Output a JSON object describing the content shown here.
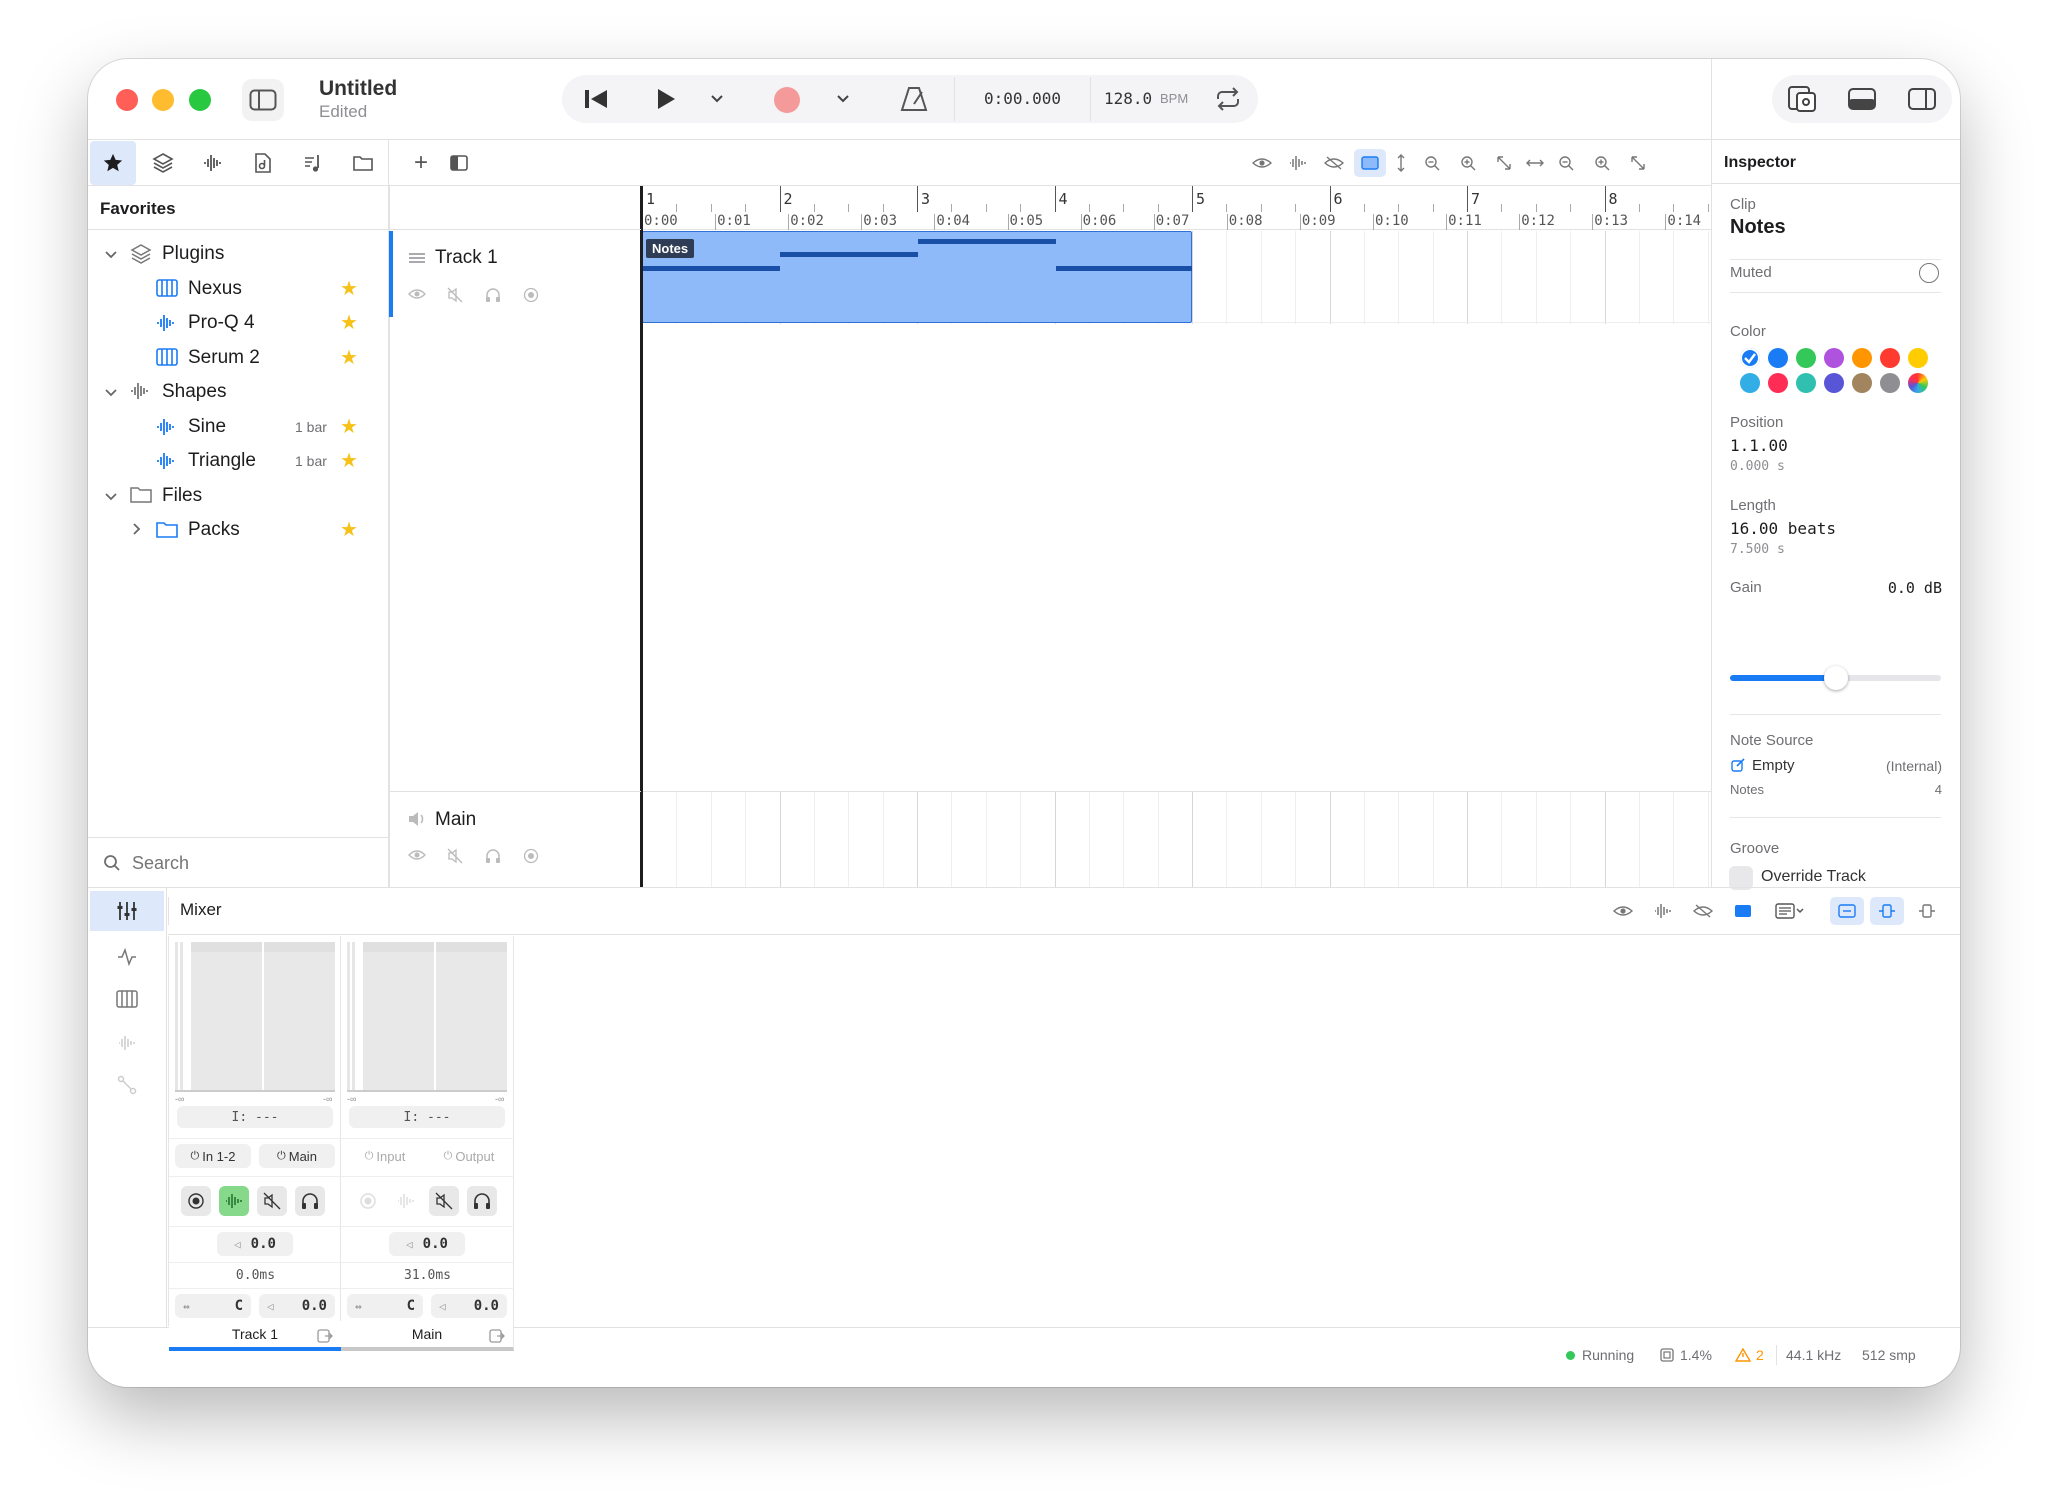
{
  "window": {
    "title": "Untitled",
    "subtitle": "Edited"
  },
  "transport": {
    "time": "0:00.000",
    "bpm_value": "128.0",
    "bpm_unit": "BPM"
  },
  "browser": {
    "heading": "Favorites",
    "search_placeholder": "Search",
    "tree": [
      {
        "label": "Plugins",
        "level": 0,
        "type": "group",
        "expanded": true
      },
      {
        "label": "Nexus",
        "level": 1,
        "icon": "piano-icon",
        "badge": "",
        "starred": true
      },
      {
        "label": "Pro-Q 4",
        "level": 1,
        "icon": "waveform-icon",
        "badge": "",
        "starred": true
      },
      {
        "label": "Serum 2",
        "level": 1,
        "icon": "piano-icon",
        "badge": "",
        "starred": true
      },
      {
        "label": "Shapes",
        "level": 0,
        "type": "group",
        "expanded": true
      },
      {
        "label": "Sine",
        "level": 1,
        "icon": "waveform-icon",
        "badge": "1 bar",
        "starred": true
      },
      {
        "label": "Triangle",
        "level": 1,
        "icon": "waveform-icon",
        "badge": "1 bar",
        "starred": true
      },
      {
        "label": "Files",
        "level": 0,
        "type": "group",
        "expanded": true
      },
      {
        "label": "Packs",
        "level": 1,
        "icon": "folder-icon",
        "badge": "",
        "starred": true
      }
    ]
  },
  "timeline": {
    "bars": [
      "1",
      "2",
      "3",
      "4",
      "5",
      "6",
      "7",
      "8"
    ],
    "times": [
      "0:00",
      "0:01",
      "0:02",
      "0:03",
      "0:04",
      "0:05",
      "0:06",
      "0:07",
      "0:08",
      "0:09",
      "0:10",
      "0:11",
      "0:12",
      "0:13",
      "0:14"
    ]
  },
  "tracks": [
    {
      "name": "Track 1"
    },
    {
      "name": "Main"
    }
  ],
  "clip": {
    "label": "Notes"
  },
  "inspector": {
    "title": "Inspector",
    "clip_label": "Clip",
    "clip_name": "Notes",
    "muted_label": "Muted",
    "color_label": "Color",
    "position_label": "Position",
    "position_value": "1.1.00",
    "position_seconds": "0.000 s",
    "length_label": "Length",
    "length_value": "16.00 beats",
    "length_seconds": "7.500 s",
    "gain_label": "Gain",
    "gain_value": "0.0 dB",
    "gain_level": 0.5,
    "note_source_label": "Note Source",
    "note_source_value": "Empty",
    "note_source_type": "(Internal)",
    "notes_label": "Notes",
    "notes_count": "4",
    "groove_label": "Groove",
    "override_track_label": "Override Track",
    "colors": [
      "#1a7cf5",
      "#1a7cf5",
      "#34c759",
      "#af52de",
      "#ff9500",
      "#ff3b30",
      "#ffcc00",
      "#32ade6",
      "#ff2d55",
      "#30c0b0",
      "#5856d6",
      "#a2845e",
      "#8e8e93",
      "#cccccc"
    ]
  },
  "mixer": {
    "title": "Mixer",
    "channels": [
      {
        "name": "Track 1",
        "input_meter": "I: ---",
        "input": "In 1-2",
        "output": "Main",
        "volume": "0.0",
        "latency": "0.0ms",
        "pan": "C",
        "send": "0.0"
      },
      {
        "name": "Main",
        "input_meter": "I: ---",
        "input": "Input",
        "output": "Output",
        "volume": "0.0",
        "latency": "31.0ms",
        "pan": "C",
        "send": "0.0"
      }
    ],
    "meter_scale": "-∞"
  },
  "status": {
    "state": "Running",
    "cpu": "1.4%",
    "warnings": "2",
    "sample_rate": "44.1 kHz",
    "buffer": "512 smp"
  }
}
